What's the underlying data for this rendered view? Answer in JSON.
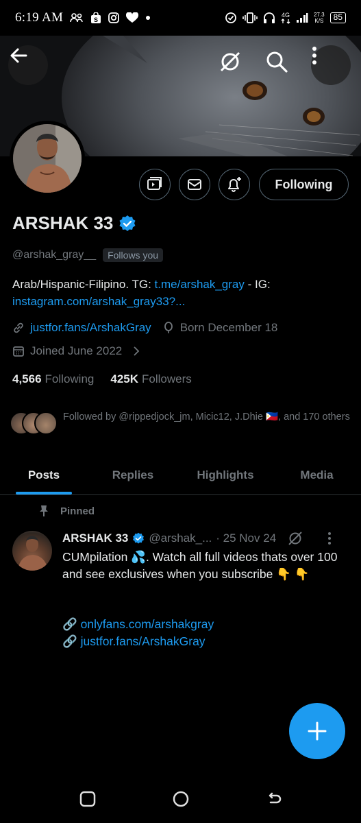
{
  "status_bar": {
    "time": "6:19 AM",
    "network": "4G",
    "net_speed_value": "27.3",
    "net_speed_unit": "K/S",
    "battery": "85"
  },
  "profile": {
    "display_name": "ARSHAK 33",
    "handle": "@arshak_gray__",
    "follows_you": "Follows you",
    "bio_text_1": "Arab/Hispanic-Filipino. TG: ",
    "bio_link_1": "t.me/arshak_gray",
    "bio_text_2": " - IG: ",
    "bio_link_2": "instagram.com/arshak_gray33?...",
    "website": "justfor.fans/ArshakGray",
    "birthday": "Born December 18",
    "joined": "Joined June 2022",
    "following_count": "4,566",
    "following_label": "Following",
    "followers_count": "425K",
    "followers_label": "Followers",
    "followed_by": "Followed by @rippedjock_jm, Micic12, J.Dhie 🇵🇭, and 170 others",
    "following_button": "Following"
  },
  "tabs": [
    {
      "label": "Posts",
      "active": true
    },
    {
      "label": "Replies",
      "active": false
    },
    {
      "label": "Highlights",
      "active": false
    },
    {
      "label": "Media",
      "active": false
    }
  ],
  "post": {
    "pinned_label": "Pinned",
    "author": "ARSHAK 33",
    "handle": "@arshak_...",
    "date": "· 25 Nov 24",
    "text": "CUMpilation 💦. Watch all full videos thats over 100 and see exclusives when you subscribe 👇 👇",
    "link_1": "onlyfans.com/arshakgray",
    "link_2": "justfor.fans/ArshakGray"
  },
  "fab_label": "+",
  "colors": {
    "accent": "#1d9bf0",
    "muted": "#71767b",
    "border": "#536471"
  }
}
